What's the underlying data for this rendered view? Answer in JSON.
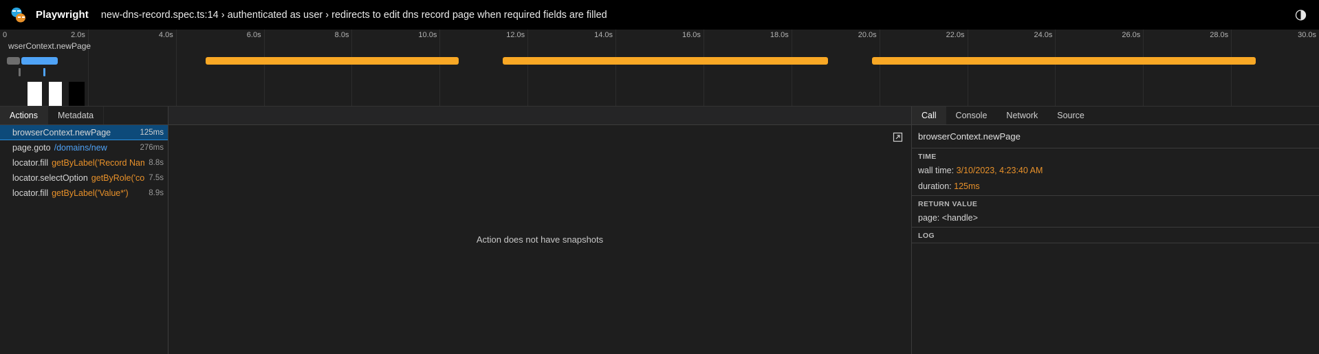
{
  "header": {
    "logo_icon": "playwright-mask-icon",
    "brand": "Playwright",
    "title_path": "new-dns-record.spec.ts:14 › authenticated as user › redirects to edit dns record page when required fields are filled",
    "theme_toggle_icon": "contrast-toggle-icon"
  },
  "timeline": {
    "tooltip_label": "wserContext.newPage",
    "ticks": [
      "0",
      "2.0s",
      "4.0s",
      "6.0s",
      "8.0s",
      "10.0s",
      "12.0s",
      "14.0s",
      "16.0s",
      "18.0s",
      "20.0s",
      "22.0s",
      "24.0s",
      "26.0s",
      "28.0s",
      "30.0s"
    ],
    "total_seconds": 30,
    "action_bar_color": "#f9a825",
    "network_gray_color": "#6e6e6e",
    "network_blue_color": "#4fa3f7",
    "bars": [
      {
        "kind": "net-gray",
        "start_pct": 0.5,
        "end_pct": 1.5
      },
      {
        "kind": "net-blue",
        "start_pct": 1.6,
        "end_pct": 4.4
      },
      {
        "kind": "action",
        "start_pct": 15.6,
        "end_pct": 34.8
      },
      {
        "kind": "action",
        "start_pct": 38.1,
        "end_pct": 62.8
      },
      {
        "kind": "action",
        "start_pct": 66.1,
        "end_pct": 95.2
      }
    ],
    "tickmarks": [
      {
        "kind": "gray",
        "pct": 1.4
      },
      {
        "kind": "blue",
        "pct": 3.3
      }
    ],
    "frames": [
      {
        "left_pct": 2.1,
        "width_pct": 1.1,
        "color": "#ffffff"
      },
      {
        "left_pct": 3.7,
        "width_pct": 1.0,
        "color": "#ffffff"
      },
      {
        "left_pct": 5.2,
        "width_pct": 1.2,
        "color": "#000000"
      }
    ]
  },
  "actions": {
    "tabs": [
      {
        "label": "Actions",
        "active": true
      },
      {
        "label": "Metadata",
        "active": false
      }
    ],
    "rows": [
      {
        "name": "browserContext.newPage",
        "param": "",
        "param_kind": "none",
        "duration": "125ms",
        "selected": true
      },
      {
        "name": "page.goto",
        "param": "/domains/new",
        "param_kind": "url",
        "duration": "276ms",
        "selected": false
      },
      {
        "name": "locator.fill",
        "param": "getByLabel('Record Name*')",
        "param_kind": "sel",
        "duration": "8.8s",
        "selected": false
      },
      {
        "name": "locator.selectOption",
        "param": "getByRole('combob…",
        "param_kind": "sel",
        "duration": "7.5s",
        "selected": false
      },
      {
        "name": "locator.fill",
        "param": "getByLabel('Value*')",
        "param_kind": "sel",
        "duration": "8.9s",
        "selected": false
      }
    ]
  },
  "snapshot": {
    "message": "Action does not have snapshots",
    "popout_icon": "external-link-icon"
  },
  "details": {
    "tabs": [
      {
        "label": "Call",
        "active": true
      },
      {
        "label": "Console",
        "active": false
      },
      {
        "label": "Network",
        "active": false
      },
      {
        "label": "Source",
        "active": false
      }
    ],
    "call_title": "browserContext.newPage",
    "sections": [
      {
        "heading": "TIME",
        "rows": [
          {
            "key": "wall time:",
            "value": "3/10/2023, 4:23:40 AM"
          },
          {
            "key": "duration:",
            "value": "125ms"
          }
        ]
      },
      {
        "heading": "RETURN VALUE",
        "rows": [
          {
            "key": "page:",
            "value": "<handle>"
          }
        ]
      },
      {
        "heading": "LOG",
        "rows": []
      }
    ]
  }
}
